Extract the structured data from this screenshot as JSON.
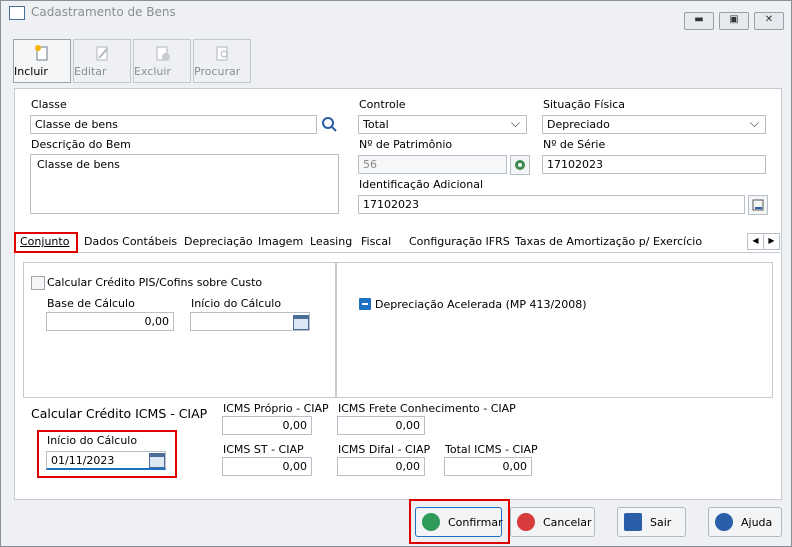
{
  "window": {
    "title": "Cadastramento de Bens",
    "min": "▬",
    "max": "▣",
    "close": "✕"
  },
  "toolbar": {
    "incluir": "Incluir",
    "editar": "Editar",
    "excluir": "Excluir",
    "procurar": "Procurar"
  },
  "form": {
    "classe_label": "Classe",
    "classe_value": "Classe de bens",
    "controle_label": "Controle",
    "controle_value": "Total",
    "situacao_label": "Situação Física",
    "situacao_value": "Depreciado",
    "descricao_label": "Descrição do Bem",
    "descricao_value": "Classe de bens",
    "patrimonio_label": "Nº de Patrimônio",
    "patrimonio_value": "56",
    "serie_label": "Nº de Série",
    "serie_value": "17102023",
    "identificacao_label": "Identificação Adicional",
    "identificacao_value": "17102023"
  },
  "tabs": [
    "Conjunto",
    "Dados Contábeis",
    "Depreciação",
    "Imagem",
    "Leasing",
    "Fiscal",
    "Configuração IFRS",
    "Taxas de Amortização p/ Exercício"
  ],
  "conjunto": {
    "pis_label": "Calcular Crédito PIS/Cofins sobre Custo",
    "base_label": "Base de Cálculo",
    "base_value": "0,00",
    "inicio_label": "Início do Cálculo",
    "inicio_value": "",
    "depreciacao_label": "Depreciação Acelerada (MP 413/2008)",
    "icms_title": "Calcular Crédito ICMS - CIAP",
    "icms_inicio_label": "Início do Cálculo",
    "icms_inicio_value": "01/11/2023",
    "icms_proprio_label": "ICMS Próprio - CIAP",
    "icms_proprio_value": "0,00",
    "icms_frete_label": "ICMS Frete Conhecimento - CIAP",
    "icms_frete_value": "0,00",
    "icms_st_label": "ICMS ST - CIAP",
    "icms_st_value": "0,00",
    "icms_difal_label": "ICMS Difal - CIAP",
    "icms_difal_value": "0,00",
    "total_icms_label": "Total ICMS - CIAP",
    "total_icms_value": "0,00"
  },
  "buttons": {
    "confirmar": "Confirmar",
    "cancelar": "Cancelar",
    "sair": "Sair",
    "ajuda": "Ajuda"
  },
  "colors": {
    "highlight": "#e00000",
    "accent": "#1f6fc2",
    "confirm": "#2e9b5a",
    "cancel": "#d83b3b",
    "help": "#2a5ea8"
  }
}
